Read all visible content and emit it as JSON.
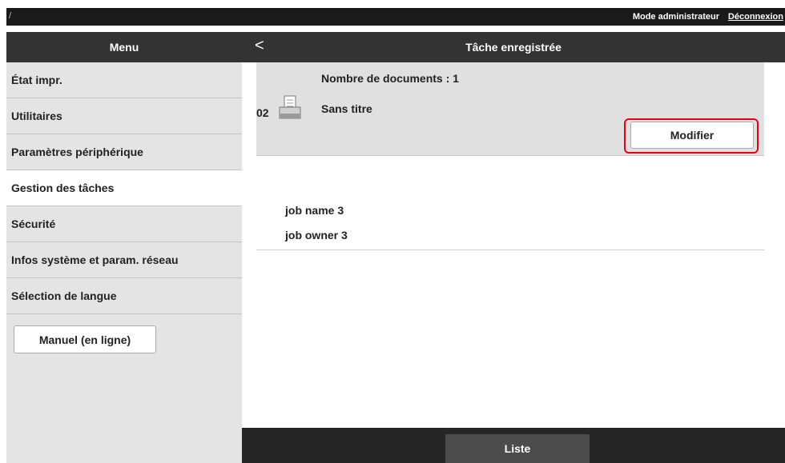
{
  "header": {
    "slash": "/",
    "mode_label": "Mode administrateur",
    "logout_label": "Déconnexion"
  },
  "menu": {
    "title": "Menu",
    "items": [
      {
        "label": "État impr."
      },
      {
        "label": "Utilitaires"
      },
      {
        "label": "Paramètres périphérique"
      },
      {
        "label": "Gestion des tâches",
        "active": true
      },
      {
        "label": "Sécurité"
      },
      {
        "label": "Infos système et param. réseau"
      },
      {
        "label": "Sélection de langue"
      }
    ],
    "manual_label": "Manuel (en ligne)"
  },
  "main": {
    "back_symbol": "<",
    "title": "Tâche enregistrée",
    "job": {
      "count_text": "Nombre de documents : 1",
      "number": "02",
      "icon": "document-tray-icon",
      "title": "Sans titre",
      "modify_label": "Modifier",
      "highlight_color": "#e60012"
    },
    "job_name": "job name 3",
    "job_owner": "job owner 3"
  },
  "footer": {
    "list_label": "Liste"
  }
}
